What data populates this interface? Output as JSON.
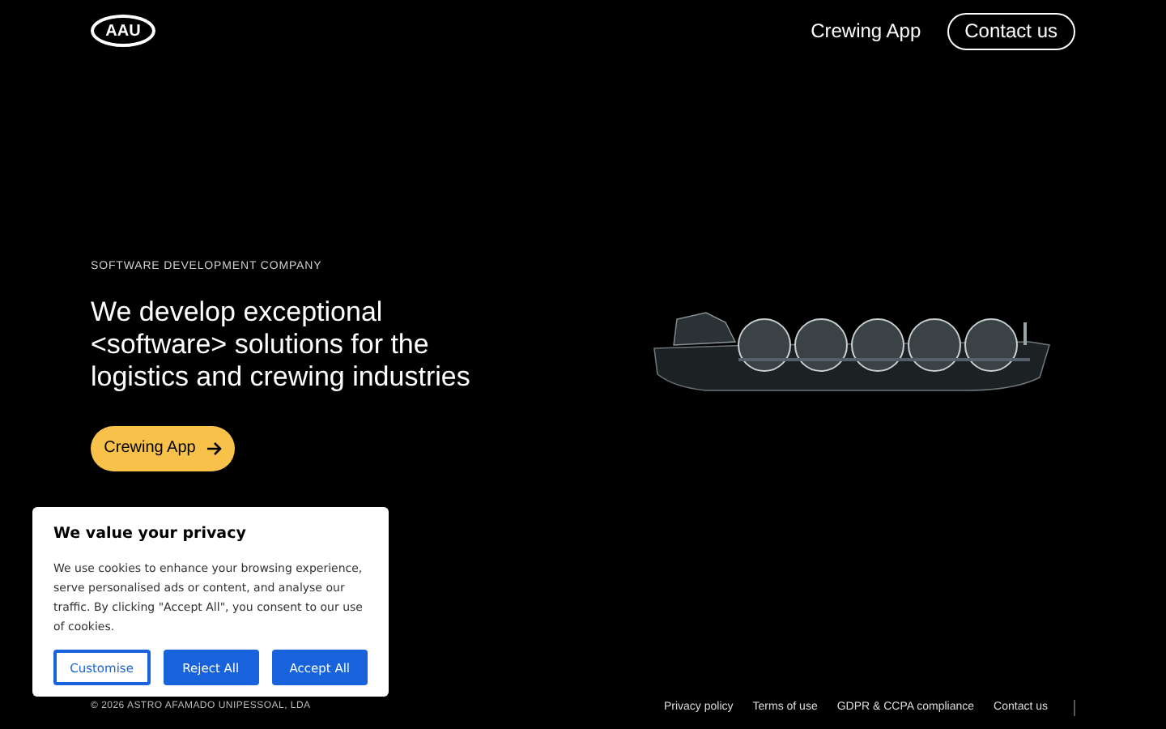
{
  "header": {
    "logo": "AAU",
    "nav": [
      {
        "label": "Crewing App",
        "kind": "link"
      },
      {
        "label": "Contact us",
        "kind": "outlined"
      }
    ]
  },
  "hero": {
    "eyebrow": "SOFTWARE DEVELOPMENT COMPANY",
    "heading": "We develop exceptional <software> solutions for the logistics and crewing industries",
    "cta": "Crewing App"
  },
  "cookie_banner": {
    "title": "We value your privacy",
    "text": "We use cookies to enhance your browsing experience, serve personalised ads or content, and analyse our traffic. By clicking \"Accept All\", you consent to our use of cookies.",
    "buttons": [
      {
        "label": "Customise",
        "kind": "outlined"
      },
      {
        "label": "Reject All",
        "kind": "filled"
      },
      {
        "label": "Accept All",
        "kind": "filled"
      }
    ]
  },
  "footer": {
    "copyright": "© 2026 ASTRO AFAMADO UNIPESSOAL, LDA",
    "links": [
      "Privacy policy",
      "Terms of use",
      "GDPR & CCPA compliance",
      "Contact us"
    ]
  }
}
